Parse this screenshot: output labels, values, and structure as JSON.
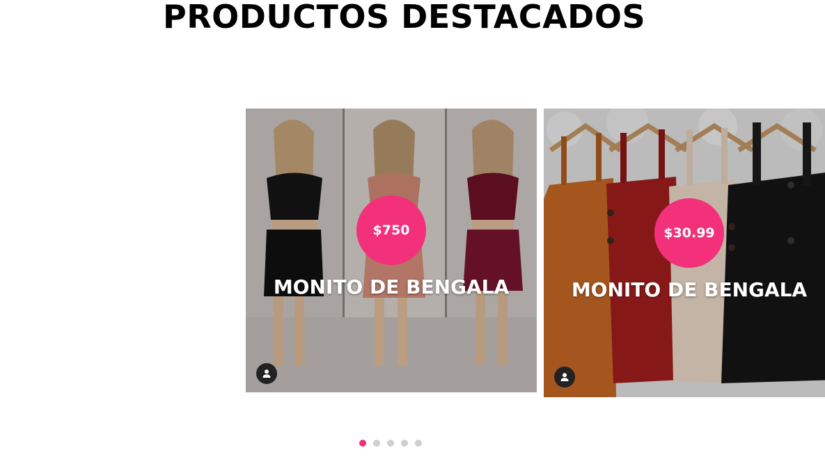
{
  "section": {
    "title": "PRODUCTOS DESTACADOS"
  },
  "products": [
    {
      "name": "MONITO DE BENGALA",
      "price": "$750",
      "image_description_icon": "image-photo-icon"
    },
    {
      "name": "MONITO DE BENGALA",
      "price": "$30.99",
      "image_description_icon": "image-photo-icon"
    }
  ],
  "carousel": {
    "active_index": 0,
    "dot_count": 5
  },
  "colors": {
    "accent": "#f2317a",
    "dot_inactive": "#cfcfcf",
    "title": "#000000"
  }
}
